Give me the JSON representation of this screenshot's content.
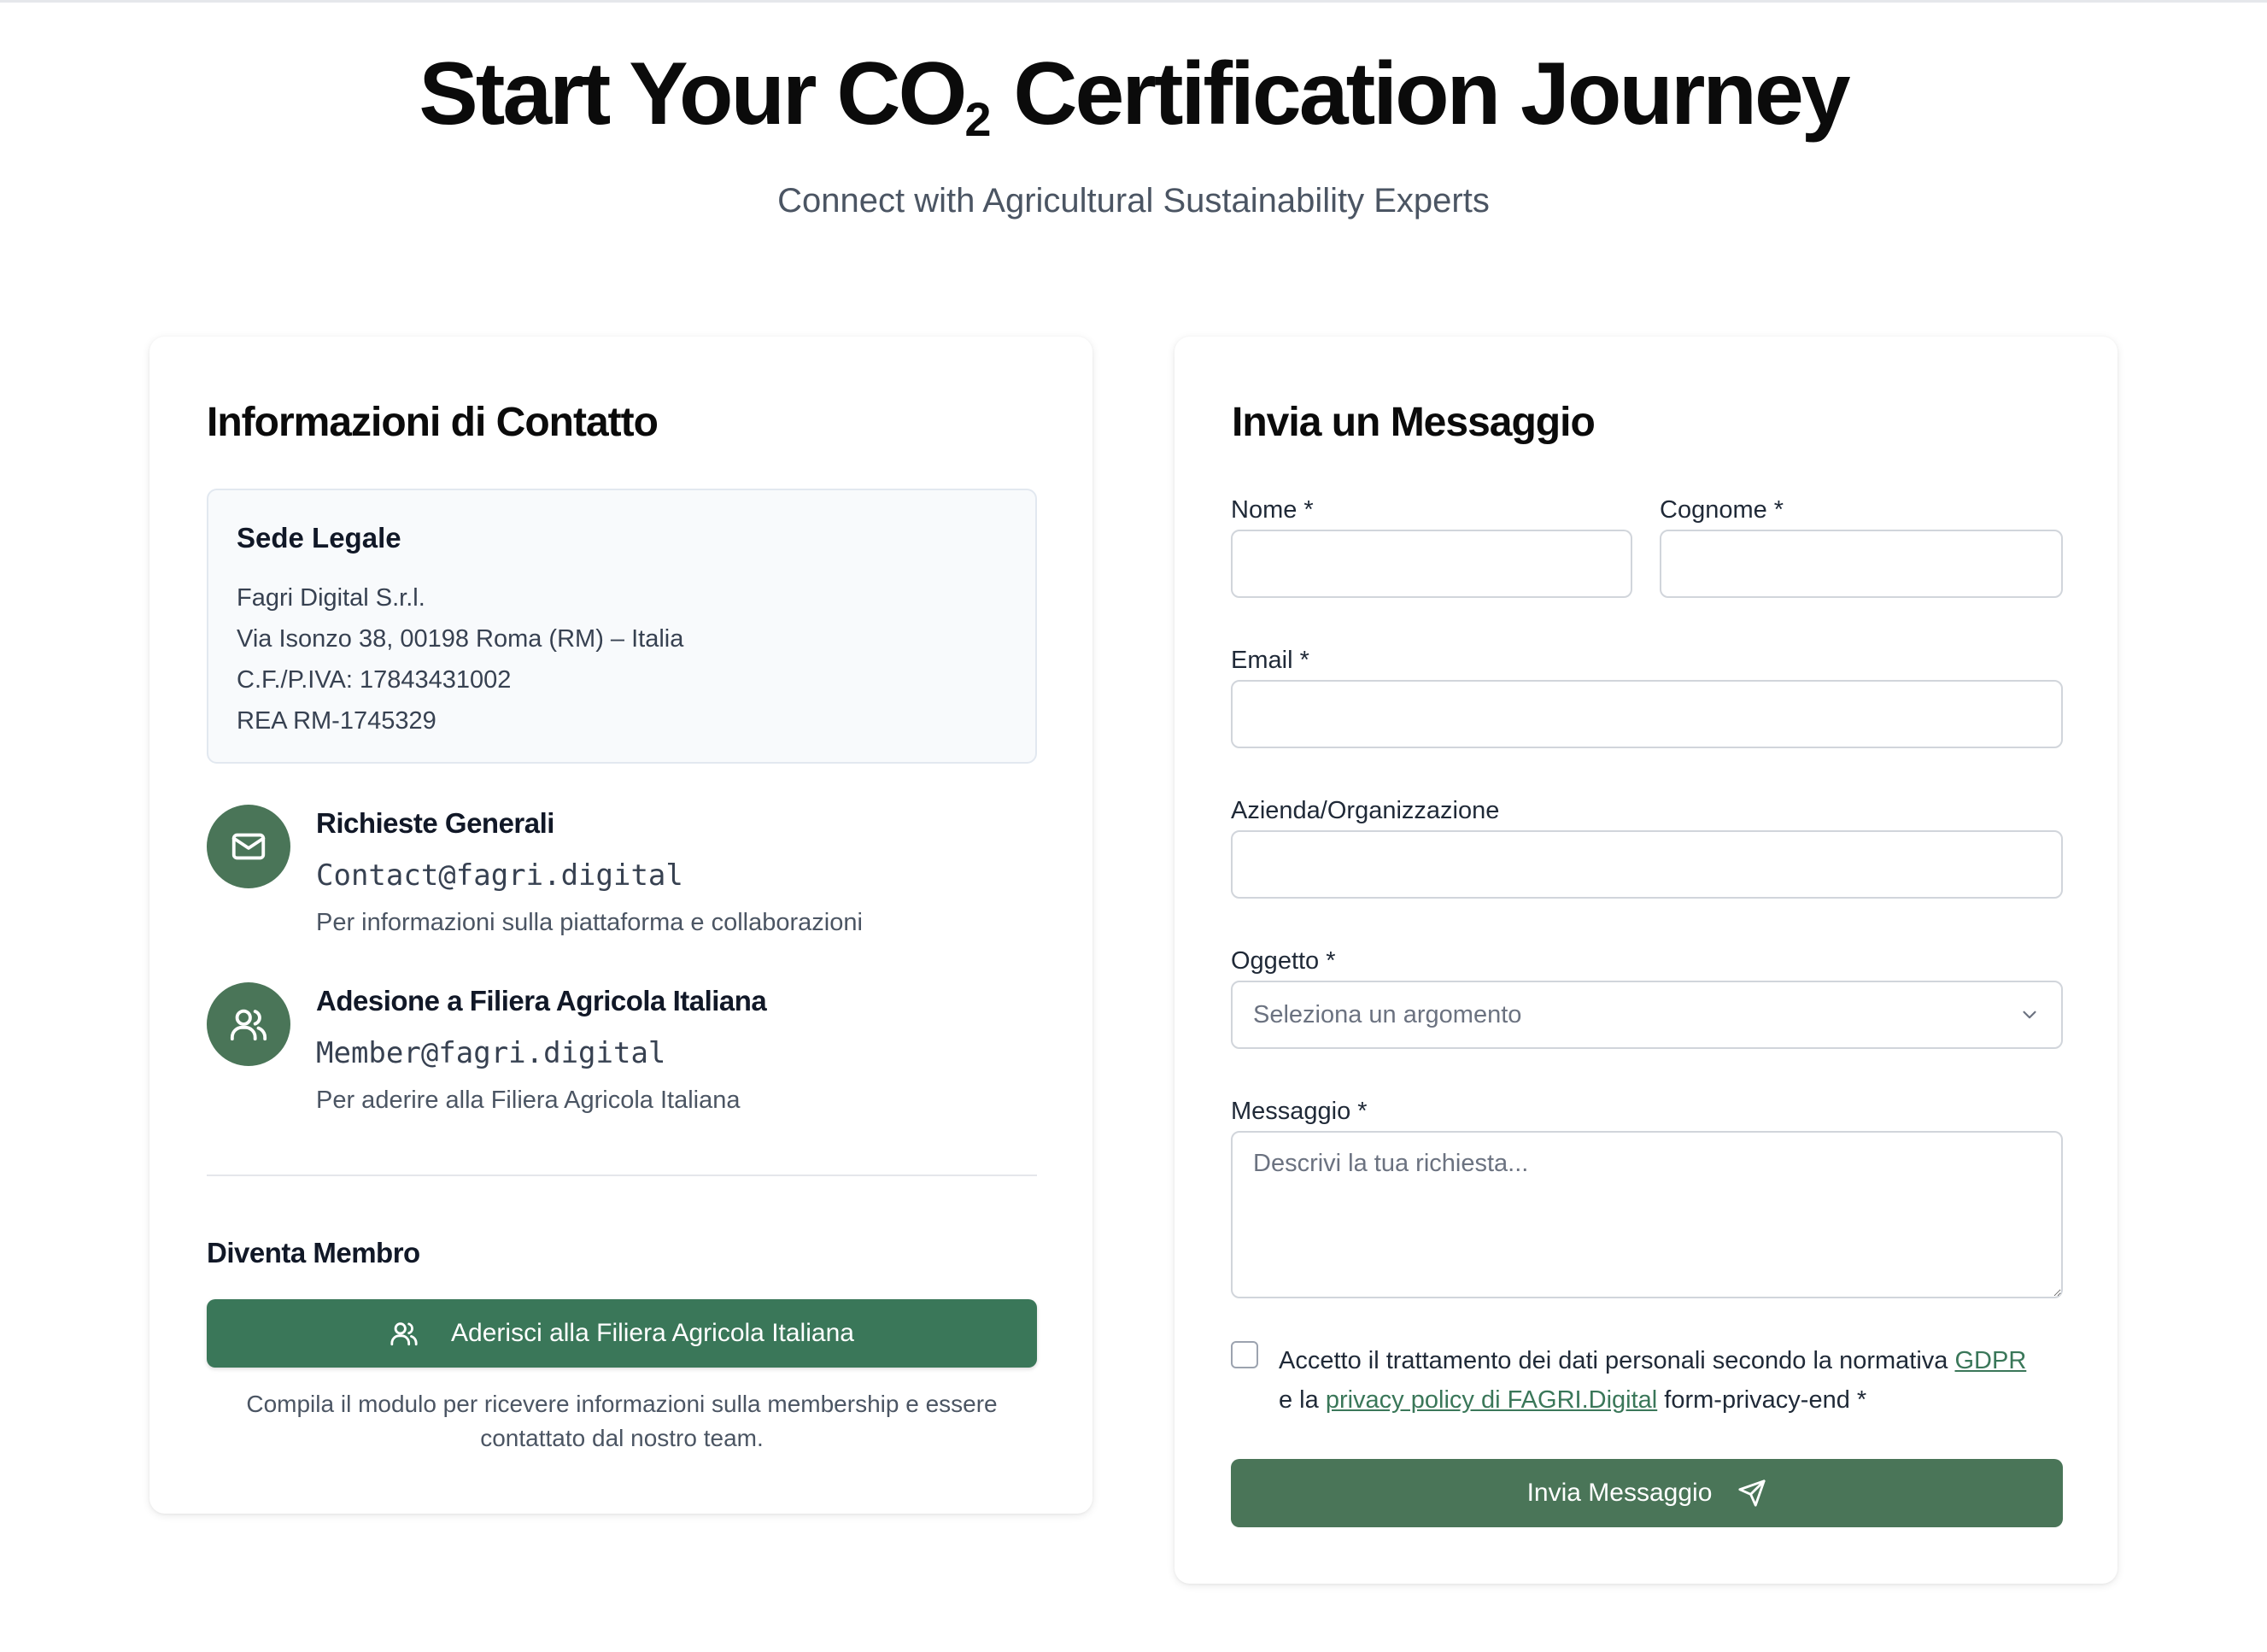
{
  "hero": {
    "title_pre": "Start Your CO",
    "title_sub": "2",
    "title_post": " Certification Journey",
    "subtitle": "Connect with Agricultural Sustainability Experts"
  },
  "contact_card": {
    "title": "Informazioni di Contatto",
    "sede": {
      "title": "Sede Legale",
      "lines": [
        "Fagri Digital S.r.l.",
        "Via Isonzo 38, 00198 Roma (RM) – Italia",
        "C.F./P.IVA: 17843431002",
        "REA RM-1745329"
      ]
    },
    "contacts": [
      {
        "icon": "mail-icon",
        "title": "Richieste Generali",
        "email": "Contact@fagri.digital",
        "description": "Per informazioni sulla piattaforma e collaborazioni"
      },
      {
        "icon": "users-icon",
        "title": "Adesione a Filiera Agricola Italiana",
        "email": "Member@fagri.digital",
        "description": "Per aderire alla Filiera Agricola Italiana"
      }
    ],
    "member": {
      "title": "Diventa Membro",
      "button_label": "Aderisci alla Filiera Agricola Italiana",
      "note": "Compila il modulo per ricevere informazioni sulla membership e essere contattato dal nostro team."
    }
  },
  "form_card": {
    "title": "Invia un Messaggio",
    "fields": {
      "nome": {
        "label": "Nome *",
        "value": ""
      },
      "cognome": {
        "label": "Cognome *",
        "value": ""
      },
      "email": {
        "label": "Email *",
        "value": ""
      },
      "azienda": {
        "label": "Azienda/Organizzazione",
        "value": ""
      },
      "oggetto": {
        "label": "Oggetto *",
        "selected": "Seleziona un argomento"
      },
      "messaggio": {
        "label": "Messaggio *",
        "placeholder": "Descrivi la tua richiesta..."
      }
    },
    "consent": {
      "text_before": "Accetto il trattamento dei dati personali secondo la normativa ",
      "gdpr_link": "GDPR",
      "text_middle": " e la ",
      "privacy_link": "privacy policy di FAGRI.Digital",
      "text_after": " form-privacy-end *",
      "checked": false
    },
    "submit_label": "Invia Messaggio"
  },
  "colors": {
    "accent_green": "#3a7759",
    "icon_circle": "#4a7558",
    "submit_button": "#4a7558"
  }
}
